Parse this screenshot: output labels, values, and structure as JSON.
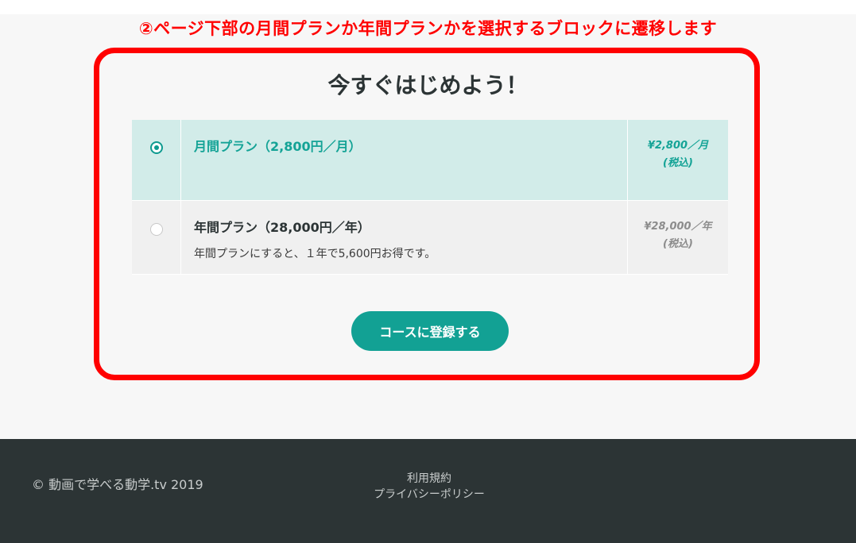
{
  "annotation": {
    "text": "②ページ下部の月間プランか年間プランかを選択するブロックに遷移します",
    "color": "#ff0000"
  },
  "main": {
    "title": "今すぐはじめよう！",
    "plans": [
      {
        "name": "月間プラン（2,800円／月）",
        "description": "",
        "price": "¥2,800／月",
        "tax_note": "(税込)",
        "selected": true
      },
      {
        "name": "年間プラン（28,000円／年）",
        "description": "年間プランにすると、１年で5,600円お得です。",
        "price": "¥28,000／年",
        "tax_note": "(税込)",
        "selected": false
      }
    ],
    "register_button_label": "コースに登録する"
  },
  "footer": {
    "copyright": "© 動画で学べる動学.tv 2019",
    "links": [
      "利用規約",
      "プライバシーポリシー"
    ]
  },
  "colors": {
    "accent": "#12a194",
    "footer_bg": "#2c3435",
    "selected_bg": "#d2ece9"
  }
}
